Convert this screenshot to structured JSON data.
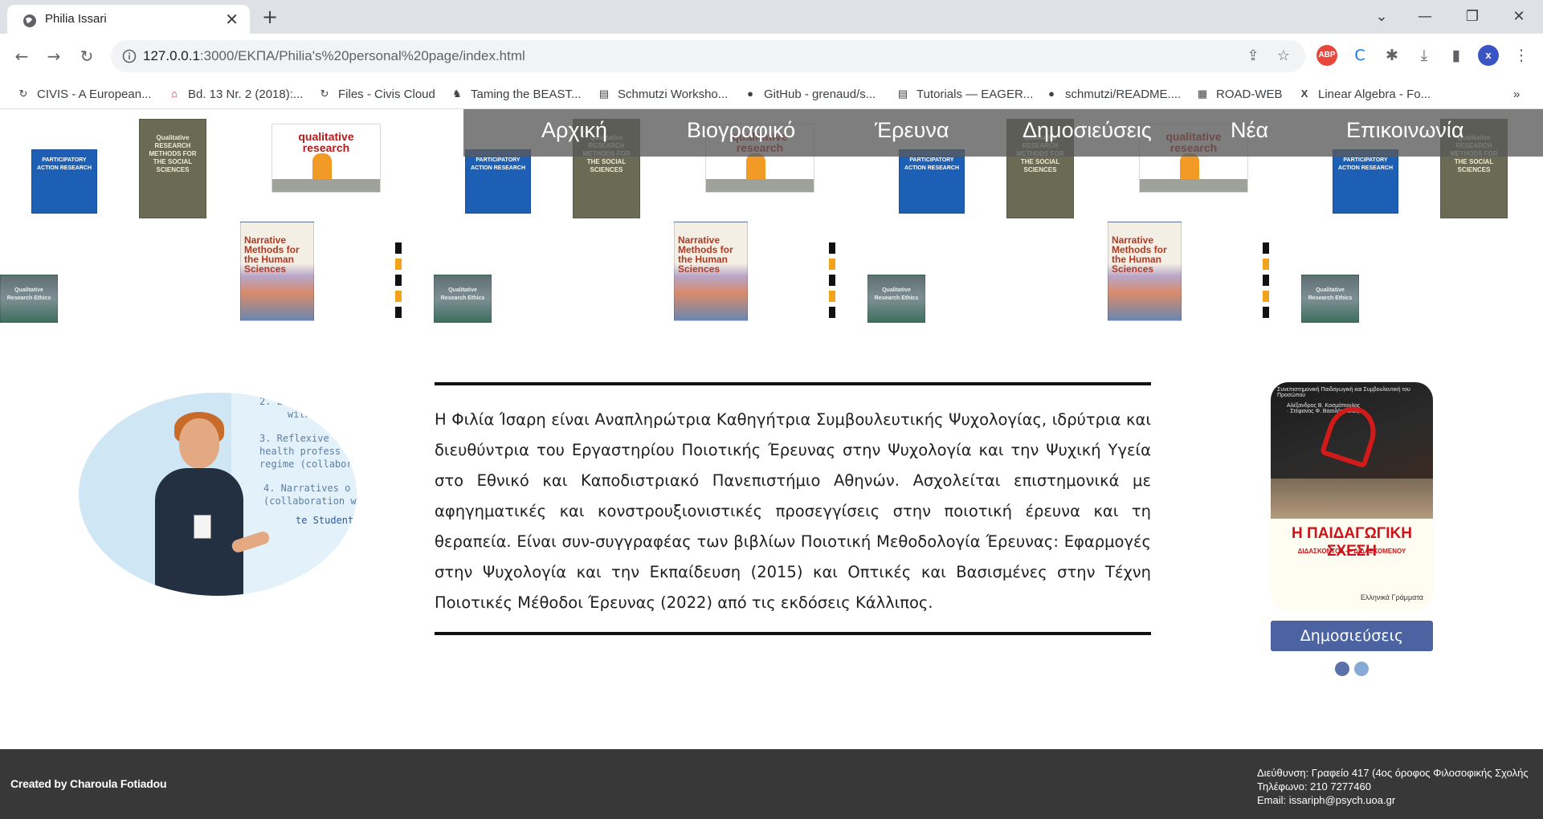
{
  "browser": {
    "tab_title": "Philia Issari",
    "url_host": "127.0.0.1",
    "url_path": ":3000/ΕΚΠΑ/Philia's%20personal%20page/index.html",
    "extension_abp_label": "ABP",
    "profile_initial": "x",
    "bookmarks": [
      {
        "label": "CIVIS - A European...",
        "icon": "reload-icon"
      },
      {
        "label": "Bd. 13 Nr. 2 (2018):...",
        "icon": "journal-icon"
      },
      {
        "label": "Files - Civis Cloud",
        "icon": "reload-icon"
      },
      {
        "label": "Taming the BEAST...",
        "icon": "beast-icon"
      },
      {
        "label": "Schmutzi Worksho...",
        "icon": "doc-icon"
      },
      {
        "label": "GitHub - grenaud/s...",
        "icon": "github-icon"
      },
      {
        "label": "Tutorials — EAGER...",
        "icon": "doc-icon"
      },
      {
        "label": "schmutzi/README....",
        "icon": "github-icon"
      },
      {
        "label": "ROAD-WEB",
        "icon": "map-icon"
      },
      {
        "label": "Linear Algebra - Fo...",
        "icon": "x-icon"
      }
    ]
  },
  "page": {
    "nav": [
      "Αρχική",
      "Βιογραφικό",
      "Έρευνα",
      "Δημοσιεύσεις",
      "Νέα",
      "Επικοινωνία"
    ],
    "books": {
      "par": "PARTICIPATORY ACTION RESEARCH",
      "qrm": "Qualitative RESEARCH METHODS FOR THE SOCIAL SCIENCES",
      "qr": "qualitative research",
      "narr": "Narrative Methods for the Human Sciences",
      "eth": "Qualitative Research Ethics"
    },
    "portrait_screen_lines": [
      "2. Lit",
      "with",
      "3. Reflexive s",
      "health profess",
      "regime (collabora",
      "4. Narratives o",
      "(collaboration wit",
      "te Students"
    ],
    "bio": "Η Φιλία Ίσαρη είναι Αναπληρώτρια Καθηγήτρια Συμβουλευτικής Ψυχολογίας, ιδρύτρια και διευθύντρια του Εργαστηρίου Ποιοτικής Έρευνας στην Ψυχολογία και την Ψυχική Υγεία στο Εθνικό και Καποδιστριακό Πανεπιστήμιο Αθηνών. Ασχολείται επιστημονικά με αφηγηματικές και κονστρουξιονιστικές προσεγγίσεις στην ποιοτική έρευνα και τη θεραπεία. Είναι συν-συγγραφέας των βιβλίων Ποιοτική Μεθοδολογία Έρευνας: Εφαρμογές στην Ψυχολογία και την Εκπαίδευση (2015) και Οπτικές και Βασισμένες στην Τέχνη Ποιοτικές Μέθοδοι Έρευνας (2022) από τις εκδόσεις Κάλλιπος.",
    "slide": {
      "series": "Συνεπιστημονική Παιδαγωγική και Συμβουλευτική του Προσώπου",
      "authors": "Αλέξανδρος Β. Κοσμόπουλος · Στέφανος Φ. Βασιλόπουλος",
      "title": "Η ΠΑΙΔΑΓΩΓΙΚΗ ΣΧΕΣΗ",
      "subtitle": "ΔΙΔΑΣΚΟΝΤΟΣ — ΔΙΔΑΣΚΟΜΕΝΟΥ",
      "publisher": "Ελληνικά Γράμματα"
    },
    "publications_button": "Δημοσιεύσεις",
    "carousel": {
      "count": 2,
      "active": 0,
      "color_active": "#5b70a8",
      "color_inactive": "#86a9d6"
    }
  },
  "footer": {
    "credit": "Created by Charoula Fotiadou",
    "address": "Διεύθυνση: Γραφείο 417 (4ος όροφος Φιλοσοφικής Σχολής",
    "phone": "Τηλέφωνο: 210 7277460",
    "email": "Email: issariph@psych.uoa.gr"
  }
}
